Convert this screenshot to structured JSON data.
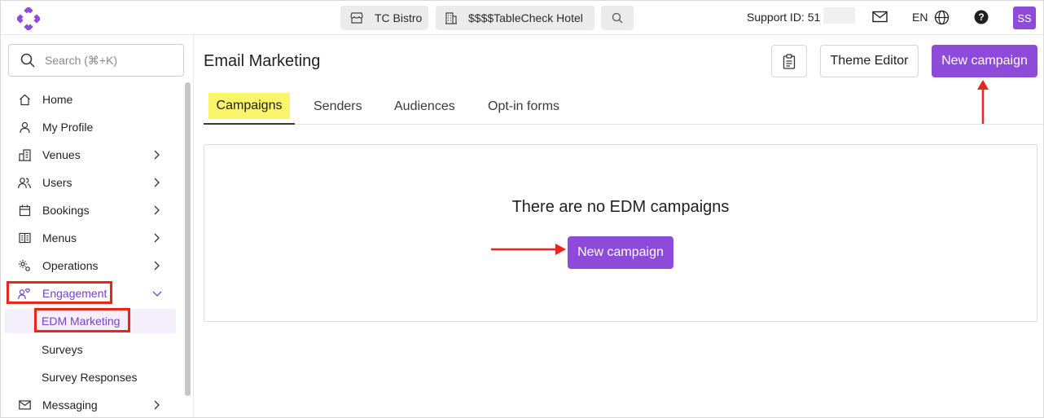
{
  "topbar": {
    "venue_chip": "TC Bistro",
    "hotel_chip": "$$$$TableCheck Hotel",
    "support_label": "Support ID: 51",
    "lang": "EN",
    "avatar": "SS",
    "icons": [
      "app-logo-icon",
      "store-icon",
      "building-icon",
      "search-icon",
      "mail-icon",
      "globe-icon",
      "help-icon"
    ]
  },
  "sidebar": {
    "search_placeholder": "Search (⌘+K)",
    "items": [
      {
        "label": "Home",
        "icon": "home-icon",
        "chevron": false
      },
      {
        "label": "My Profile",
        "icon": "person-icon",
        "chevron": false
      },
      {
        "label": "Venues",
        "icon": "venues-icon",
        "chevron": true
      },
      {
        "label": "Users",
        "icon": "users-icon",
        "chevron": true
      },
      {
        "label": "Bookings",
        "icon": "calendar-icon",
        "chevron": true
      },
      {
        "label": "Menus",
        "icon": "menu-book-icon",
        "chevron": true
      },
      {
        "label": "Operations",
        "icon": "operations-icon",
        "chevron": true
      },
      {
        "label": "Engagement",
        "icon": "engagement-icon",
        "chevron": true,
        "expanded": true
      },
      {
        "label": "Messaging",
        "icon": "mail-icon",
        "chevron": true
      }
    ],
    "sub_items": [
      {
        "label": "EDM Marketing",
        "active": true
      },
      {
        "label": "Surveys"
      },
      {
        "label": "Survey Responses"
      }
    ]
  },
  "main": {
    "title": "Email Marketing",
    "theme_editor": "Theme Editor",
    "new_campaign": "New campaign",
    "tabs": [
      "Campaigns",
      "Senders",
      "Audiences",
      "Opt-in forms"
    ],
    "empty_message": "There are no EDM campaigns",
    "empty_button": "New campaign"
  },
  "colors": {
    "accent": "#8e4ad8",
    "highlight_box": "#e8261b",
    "tab_highlight": "#faf56a"
  }
}
